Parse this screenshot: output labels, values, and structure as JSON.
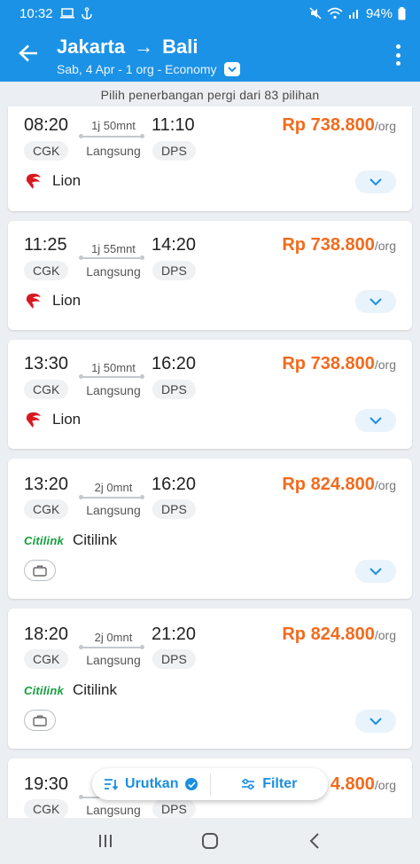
{
  "status_bar": {
    "time": "10:32",
    "battery": "94%",
    "icons": [
      "laptop-icon",
      "anchor-icon",
      "mute-icon",
      "wifi-icon",
      "signal-icon",
      "battery-icon"
    ]
  },
  "header": {
    "origin": "Jakarta",
    "destination": "Bali",
    "arrow": "→",
    "subtitle": "Sab, 4 Apr - 1 org - Economy",
    "bg_color": "#1b92e6"
  },
  "info_banner": "Pilih penerbangan pergi dari 83 pilihan",
  "flights": [
    {
      "dep_time": "08:20",
      "arr_time": "11:10",
      "duration": "1j 50mnt",
      "transit": "Langsung",
      "dep_airport": "CGK",
      "arr_airport": "DPS",
      "price": "Rp 738.800",
      "unit": "/org",
      "airline": "Lion",
      "logo": "lion-icon"
    },
    {
      "dep_time": "11:25",
      "arr_time": "14:20",
      "duration": "1j 55mnt",
      "transit": "Langsung",
      "dep_airport": "CGK",
      "arr_airport": "DPS",
      "price": "Rp 738.800",
      "unit": "/org",
      "airline": "Lion",
      "logo": "lion-icon"
    },
    {
      "dep_time": "13:30",
      "arr_time": "16:20",
      "duration": "1j 50mnt",
      "transit": "Langsung",
      "dep_airport": "CGK",
      "arr_airport": "DPS",
      "price": "Rp 738.800",
      "unit": "/org",
      "airline": "Lion",
      "logo": "lion-icon"
    },
    {
      "dep_time": "13:20",
      "arr_time": "16:20",
      "duration": "2j 0mnt",
      "transit": "Langsung",
      "dep_airport": "CGK",
      "arr_airport": "DPS",
      "price": "Rp 824.800",
      "unit": "/org",
      "airline": "Citilink",
      "logo_text": "Citilink"
    },
    {
      "dep_time": "18:20",
      "arr_time": "21:20",
      "duration": "2j 0mnt",
      "transit": "Langsung",
      "dep_airport": "CGK",
      "arr_airport": "DPS",
      "price": "Rp 824.800",
      "unit": "/org",
      "airline": "Citilink",
      "logo_text": "Citilink"
    },
    {
      "dep_time": "19:30",
      "dep_airport": "CGK",
      "arr_airport": "DPS",
      "transit": "Langsung",
      "price_partial": "4.800",
      "unit": "/org"
    }
  ],
  "actions": {
    "sort_label": "Urutkan",
    "filter_label": "Filter",
    "accent_color": "#1b8fe0"
  },
  "colors": {
    "price": "#f26b1d",
    "lion_red": "#d71920",
    "citilink_green": "#12a13c"
  }
}
